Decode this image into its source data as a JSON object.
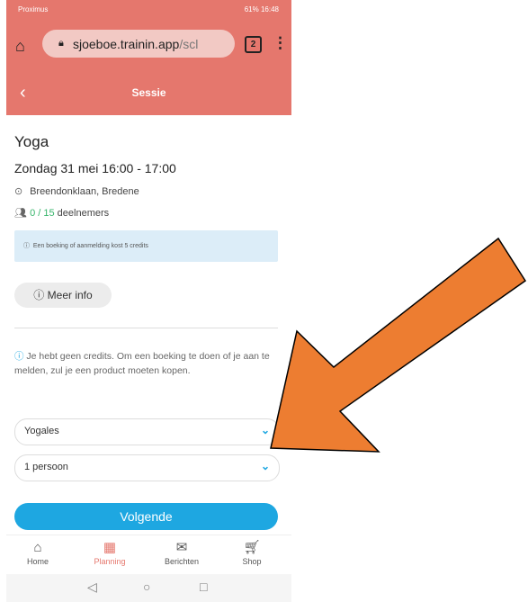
{
  "statusbar": {
    "left": "Proximus",
    "right": "61% 16:48"
  },
  "browser": {
    "url_main": "sjoeboe.trainin.app",
    "url_rest": "/scl",
    "tabs_count": "2"
  },
  "header": {
    "title": "Sessie"
  },
  "session": {
    "name": "Yoga",
    "datetime": "Zondag 31 mei 16:00 - 17:00",
    "location": "Breendonklaan, Bredene",
    "participants_count": "0 / 15",
    "participants_label": "deelnemers"
  },
  "notice": {
    "text": "Een boeking of aanmelding kost 5 credits"
  },
  "more_info": {
    "label": "Meer info"
  },
  "credit_note": {
    "text": "Je hebt geen credits. Om een boeking te doen of je aan te melden, zul je een product moeten kopen."
  },
  "selects": {
    "product": "Yogales",
    "persons": "1 persoon"
  },
  "next": {
    "label": "Volgende"
  },
  "nav": {
    "home": "Home",
    "planning": "Planning",
    "messages": "Berichten",
    "shop": "Shop"
  },
  "colors": {
    "accent": "#e5776d",
    "primary": "#1ea7e1",
    "arrow": "#ed7d31"
  }
}
